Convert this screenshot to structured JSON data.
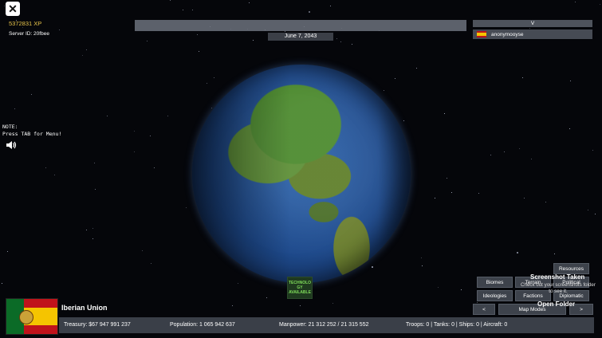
{
  "window": {
    "close_icon": "close-icon"
  },
  "player": {
    "xp": "5372831 XP",
    "server_id": "Server ID: 20fbee",
    "date": "June 7, 2043",
    "list_toggle": "V",
    "list": [
      {
        "name": "anonymooyse",
        "flag_icon": "spain-flag-icon"
      }
    ]
  },
  "note": {
    "line1": "NOTE:",
    "line2": "Press TAB for Menu!"
  },
  "volume": {
    "icon": "speaker-icon"
  },
  "tech_badge": {
    "line1": "TECHNOLO",
    "line2": "GY",
    "line3": "AVAILABLE"
  },
  "map_panel": {
    "resources": "Resources",
    "biomes": "Biomes",
    "terrain": "Terrain",
    "political": "Political",
    "ideologies": "Ideologies",
    "factions": "Factions",
    "diplomatic": "Diplomatic",
    "prev": "<",
    "map_modes": "Map Modes",
    "next": ">"
  },
  "toast": {
    "title": "Screenshot Taken",
    "body": "Check out your screenshots folder to see it.",
    "action": "Open Folder"
  },
  "country": {
    "name": "Iberian Union",
    "treasury": "Treasury:  $67 947 991 237",
    "population": "Population: 1 065 942 637",
    "manpower": "Manpower:  21 312 252  /  21 315 552",
    "troops": "Troops: 0  |  Tanks: 0  |  Ships: 0  |  Aircraft: 0"
  },
  "colors": {
    "xp": "#e6c24a",
    "panel": "#3d424b",
    "tech": "#7fdc5a"
  }
}
